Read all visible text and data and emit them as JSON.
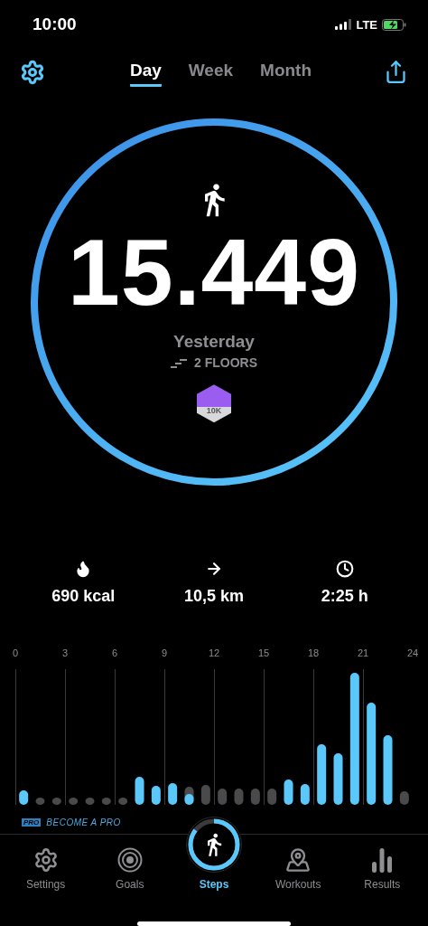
{
  "status_bar": {
    "time": "10:00",
    "network": "LTE"
  },
  "tabs": [
    {
      "label": "Day",
      "selected": true
    },
    {
      "label": "Week",
      "selected": false
    },
    {
      "label": "Month",
      "selected": false
    }
  ],
  "summary": {
    "steps": "15.449",
    "day": "Yesterday",
    "floors": "2 FLOORS",
    "badge": "10K"
  },
  "stats": [
    {
      "kind": "energy",
      "value": "690 kcal"
    },
    {
      "kind": "distance",
      "value": "10,5 km"
    },
    {
      "kind": "time",
      "value": "2:25 h"
    }
  ],
  "hour_labels": [
    "0",
    "3",
    "6",
    "9",
    "12",
    "15",
    "18",
    "21",
    "24"
  ],
  "promo": {
    "tag": "PRO",
    "text": "BECOME A PRO"
  },
  "nav": [
    {
      "kind": "settings",
      "label": "Settings",
      "selected": false
    },
    {
      "kind": "goals",
      "label": "Goals",
      "selected": false
    },
    {
      "kind": "steps",
      "label": "Steps",
      "selected": true
    },
    {
      "kind": "workouts",
      "label": "Workouts",
      "selected": false
    },
    {
      "kind": "results",
      "label": "Results",
      "selected": false
    }
  ]
}
